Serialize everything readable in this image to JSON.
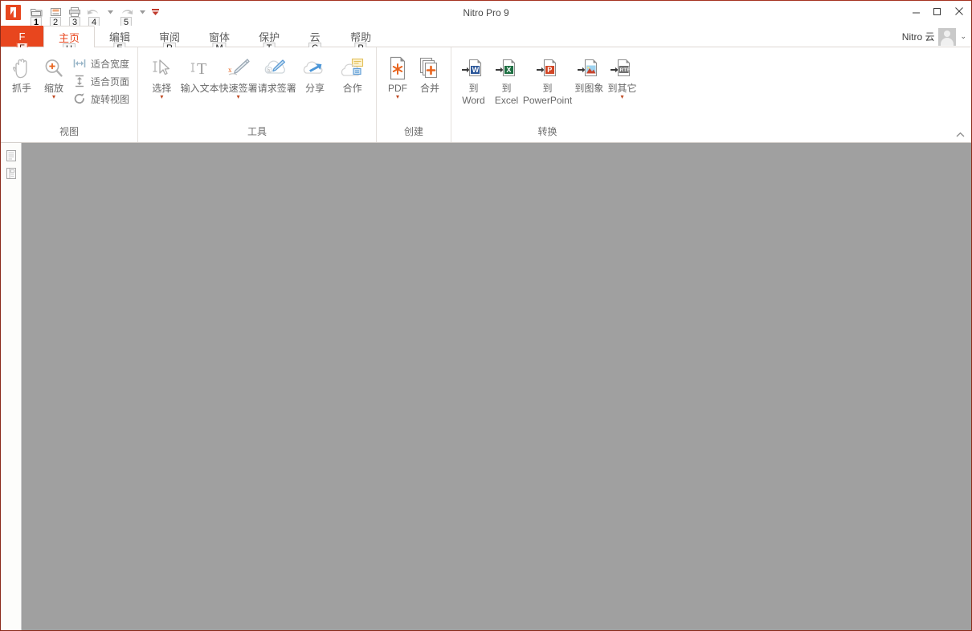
{
  "window": {
    "title": "Nitro Pro 9",
    "minimize_label": "minimize",
    "maximize_label": "maximize",
    "close_label": "close"
  },
  "quick_access": {
    "logo_name": "nitro-logo",
    "items": [
      {
        "name": "open-icon",
        "keytip": "1"
      },
      {
        "name": "save-icon",
        "keytip": "2"
      },
      {
        "name": "print-icon",
        "keytip": "3"
      },
      {
        "name": "undo-icon",
        "keytip": "4"
      },
      {
        "name": "redo-icon",
        "keytip": "5"
      }
    ],
    "customize_label": "▼"
  },
  "account": {
    "label": "Nitro 云",
    "caret": "⌄"
  },
  "tabs": {
    "file_label": "F",
    "file_keytip": "F",
    "items": [
      {
        "label": "主页",
        "keytip": "H",
        "active": true
      },
      {
        "label": "编辑",
        "keytip": "E",
        "active": false
      },
      {
        "label": "审阅",
        "keytip": "R",
        "active": false
      },
      {
        "label": "窗体",
        "keytip": "M",
        "active": false
      },
      {
        "label": "保护",
        "keytip": "T",
        "active": false
      },
      {
        "label": "云",
        "keytip": "C",
        "active": false
      },
      {
        "label": "帮助",
        "keytip": "P",
        "active": false
      }
    ]
  },
  "ribbon": {
    "collapse_label": "⌃",
    "groups": [
      {
        "label": "视图",
        "big": [
          {
            "label": "抓手",
            "icon": "hand-icon",
            "caret": ""
          },
          {
            "label": "缩放",
            "icon": "zoom-in-icon",
            "caret": "▾"
          }
        ],
        "small": [
          {
            "label": "适合宽度",
            "icon": "fit-width-icon"
          },
          {
            "label": "适合页面",
            "icon": "fit-page-icon"
          },
          {
            "label": "旋转视图",
            "icon": "rotate-view-icon"
          }
        ]
      },
      {
        "label": "工具",
        "big": [
          {
            "label": "选择",
            "icon": "select-icon",
            "caret": "▾"
          },
          {
            "label": "输入文本",
            "icon": "type-text-icon",
            "caret": ""
          },
          {
            "label": "快速签署",
            "icon": "quick-sign-icon",
            "caret": "▾"
          },
          {
            "label": "请求签署",
            "icon": "request-sign-icon",
            "caret": ""
          },
          {
            "label": "分享",
            "icon": "share-icon",
            "caret": ""
          },
          {
            "label": "合作",
            "icon": "collaborate-icon",
            "caret": ""
          }
        ],
        "small": []
      },
      {
        "label": "创建",
        "big": [
          {
            "label": "PDF",
            "icon": "create-pdf-icon",
            "caret": "▾"
          },
          {
            "label": "合并",
            "icon": "merge-icon",
            "caret": ""
          }
        ],
        "small": []
      },
      {
        "label": "转换",
        "big": [
          {
            "label": "到",
            "label2": "Word",
            "icon": "to-word-icon",
            "caret": ""
          },
          {
            "label": "到",
            "label2": "Excel",
            "icon": "to-excel-icon",
            "caret": ""
          },
          {
            "label": "到",
            "label2": "PowerPoint",
            "icon": "to-powerpoint-icon",
            "caret": ""
          },
          {
            "label": "到图象",
            "icon": "to-image-icon",
            "caret": ""
          },
          {
            "label": "到其它",
            "icon": "to-other-icon",
            "caret": "▾"
          }
        ],
        "small": []
      }
    ]
  },
  "navpane": {
    "items": [
      {
        "name": "pages-thumbnail-icon"
      },
      {
        "name": "bookmarks-icon"
      }
    ]
  },
  "document": {
    "background": "#a0a0a0",
    "content": ""
  }
}
